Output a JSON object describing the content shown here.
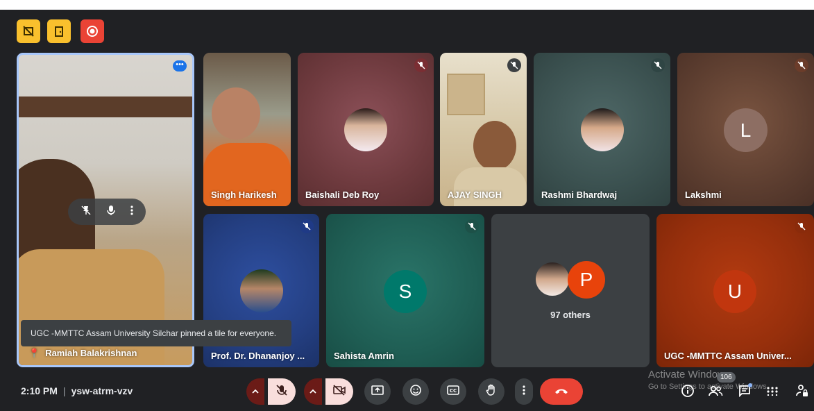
{
  "top_bar": {
    "icons": [
      "presentation-off-icon",
      "door-icon",
      "record-icon"
    ]
  },
  "tiles": [
    {
      "name": "Ramiah Balakrishnan",
      "muted": false,
      "pinned": true
    },
    {
      "name": "Singh Harikesh",
      "muted": false
    },
    {
      "name": "Baishali Deb Roy",
      "muted": true
    },
    {
      "name": "AJAY SINGH",
      "muted": true
    },
    {
      "name": "Rashmi Bhardwaj",
      "muted": true
    },
    {
      "name": "Lakshmi",
      "muted": true,
      "avatar_letter": "L",
      "avatar_color": "#8d6e63"
    },
    {
      "name": "Prof. Dr. Dhananjoy ...",
      "muted": true
    },
    {
      "name": "Sahista Amrin",
      "muted": true,
      "avatar_letter": "S",
      "avatar_color": "#00796b"
    },
    {
      "name": "UGC -MMTTC Assam Univer...",
      "muted": true,
      "avatar_letter": "U",
      "avatar_color": "#c1360e"
    }
  ],
  "others_tile": {
    "label": "97 others",
    "avatar_letter": "P",
    "avatar_color": "#e8430b"
  },
  "toast": "UGC -MMTTC Assam University Silchar pinned a tile for everyone.",
  "meeting": {
    "time": "2:10 PM",
    "separator": "|",
    "code": "ysw-atrm-vzv"
  },
  "participants_count": "106",
  "watermark": {
    "line1": "Activate Windows",
    "line2": "Go to Settings to activate Windows."
  },
  "colors": {
    "background": "#202124",
    "control_grey": "#3c4043",
    "end_call_red": "#ea4335",
    "muted_pink": "#f9dedc",
    "accent_yellow": "#f9c02d"
  }
}
